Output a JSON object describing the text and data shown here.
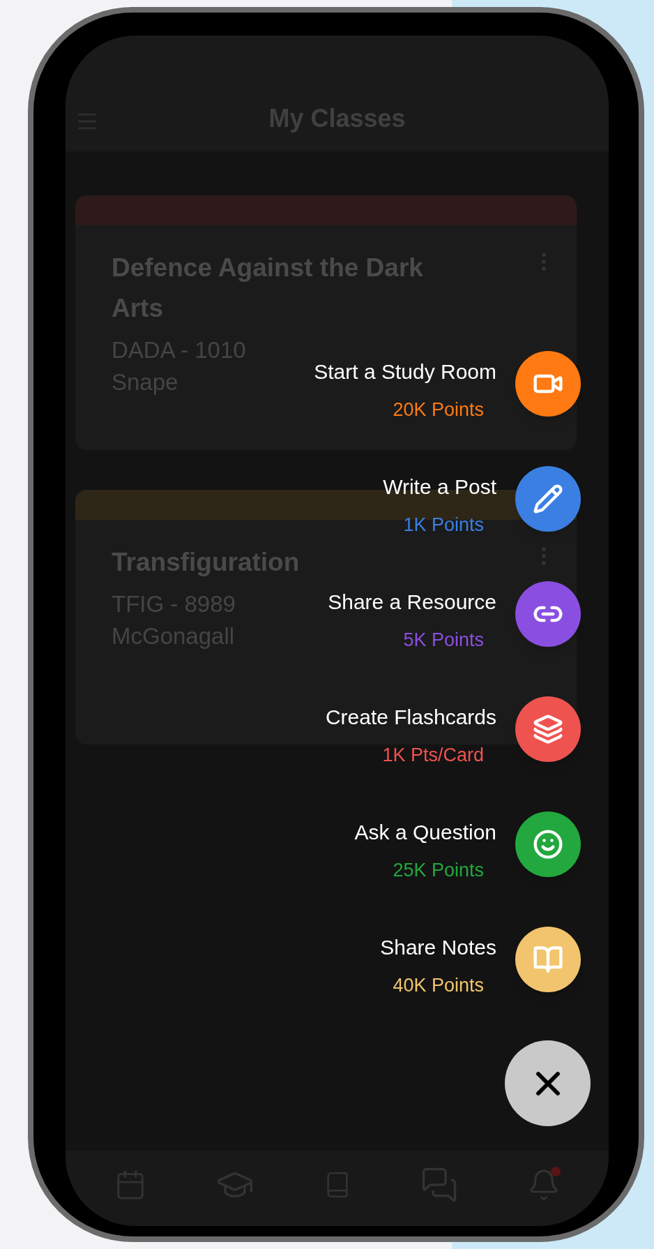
{
  "header": {
    "title": "My Classes"
  },
  "classes": [
    {
      "name": "Defence Against the Dark Arts",
      "code": "DADA - 1010",
      "teacher": "Snape",
      "color": "#2e1a1a"
    },
    {
      "name": "Transfiguration",
      "code": "TFIG - 8989",
      "teacher": "McGonagall",
      "color": "#2e2718"
    }
  ],
  "actions": [
    {
      "kind": "video",
      "label": "Start a Study Room",
      "points": "20K Points",
      "color": "#ff7a12"
    },
    {
      "kind": "pencil",
      "label": "Write a Post",
      "points": "1K Points",
      "color": "#3b7fe3"
    },
    {
      "kind": "link",
      "label": "Share a Resource",
      "points": "5K Points",
      "color": "#8a4fe0"
    },
    {
      "kind": "cards",
      "label": "Create Flashcards",
      "points": "1K Pts/Card",
      "color": "#ef5350"
    },
    {
      "kind": "smiley",
      "label": "Ask a Question",
      "points": "25K Points",
      "color": "#22a83e"
    },
    {
      "kind": "notebook",
      "label": "Share Notes",
      "points": "40K Points",
      "color": "#f2c46d"
    }
  ]
}
